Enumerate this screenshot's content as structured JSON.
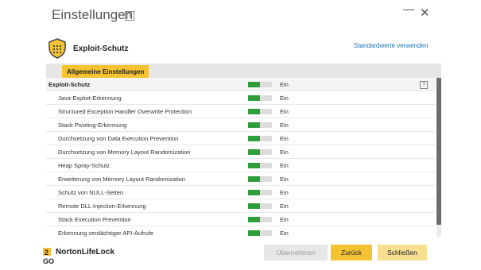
{
  "window": {
    "title": "Einstellungen",
    "help_icon": "?",
    "minimize": "—",
    "close": "✕"
  },
  "section": {
    "title": "Exploit-Schutz",
    "reset_link": "Standardwerte verwenden",
    "icon": "shield-icon"
  },
  "tabs": [
    {
      "label": "Allgemeine Einstellungen",
      "active": true
    }
  ],
  "list": {
    "header": {
      "label": "Exploit-Schutz",
      "state": "Ein",
      "help": "?",
      "on": true
    },
    "rows": [
      {
        "label": "Java-Exploit-Erkennung",
        "state": "Ein"
      },
      {
        "label": "Structured Exception Handler Overwrite Protection",
        "state": "Ein"
      },
      {
        "label": "Stack Pivoting-Erkennung",
        "state": "Ein"
      },
      {
        "label": "Durchsetzung von Data Execution Prevention",
        "state": "Ein"
      },
      {
        "label": "Durchsetzung von Memory Layout Randomization",
        "state": "Ein"
      },
      {
        "label": "Heap Spray-Schutz",
        "state": "Ein"
      },
      {
        "label": "Erweiterung von Memory Layout Randomization",
        "state": "Ein"
      },
      {
        "label": "Schutz von NULL-Seiten",
        "state": "Ein"
      },
      {
        "label": "Remote DLL Injection-Erkennung",
        "state": "Ein"
      },
      {
        "label": "Stack Execution Prevention",
        "state": "Ein"
      },
      {
        "label": "Erkennung verdächtiger API-Aufrufe",
        "state": "Ein"
      }
    ]
  },
  "footer": {
    "brand": "NortonLifeLock",
    "badge": "2GO",
    "apply_label": "Übernehmen",
    "back_label": "Zurück",
    "close_label": "Schließen"
  },
  "colors": {
    "accent": "#f5c231",
    "toggle_on": "#2e9e3a",
    "link": "#1a6fb0"
  }
}
